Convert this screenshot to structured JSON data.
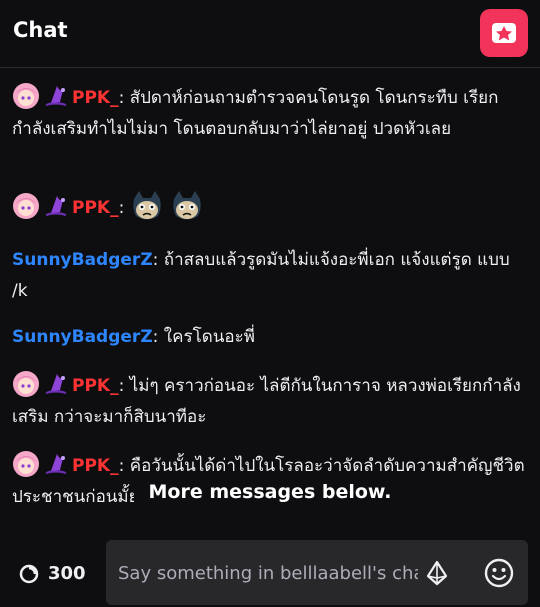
{
  "header": {
    "title": "Chat",
    "app_icon": "star-app-icon",
    "app_icon_color": "#f2345b"
  },
  "colors": {
    "ppk_name": "#ff3333",
    "sunny_name": "#2e86ff",
    "background": "#0e0e10"
  },
  "messages": [
    {
      "user": "PPK_",
      "text": ": สัปดาห์ก่อนถามตำรวจคนโดนรูด โดนกระทืบ เรียกกำลังเสริมทำไมไม่มา โดนตอบกลับมาว่าไล่ยาอยู่ ปวดหัวเลย"
    },
    {
      "user": "PPK_",
      "text": ":"
    },
    {
      "user": "SunnyBadgerZ",
      "text": ": ถ้าสลบแล้วรูดมันไม่แจ้งอะพี่เอก แจ้งแต่รูด แบบ /k"
    },
    {
      "user": "SunnyBadgerZ",
      "text": ": ใครโดนอะพี่"
    },
    {
      "user": "PPK_",
      "text": ": ไม่ๆ คราวก่อนอะ ไล่ตีกันในการาจ หลวงพ่อเรียกกำลังเสริม กว่าจะมาก็สิบนาทีอะ"
    },
    {
      "user": "PPK_",
      "text": ": คือวันนั้นได้ด่าไปในโรลอะว่าจัดลำดับความสำคัญชีวิตประชาชนก่อนมั้ย"
    }
  ],
  "more_banner": "More messages below.",
  "footer": {
    "points": "300",
    "input_placeholder": "Say something in belllaabell's chat"
  }
}
